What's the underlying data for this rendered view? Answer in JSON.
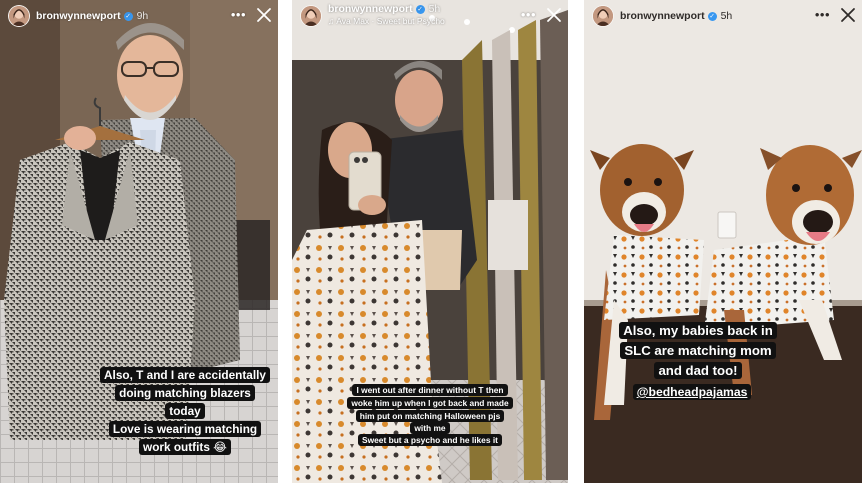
{
  "stories": [
    {
      "username": "bronwynnewport",
      "time": "9h",
      "captions": [
        [
          "Also, T and I are accidentally",
          "doing matching blazers",
          "today"
        ],
        [
          "Love is wearing matching",
          "work outfits 😂"
        ]
      ]
    },
    {
      "username": "bronwynnewport",
      "time": "5h",
      "music": "♫ Ava Max · Sweet but Psycho",
      "captions": [
        [
          "I went out after dinner without T then",
          "woke him up when I got back and made",
          "him put on matching Halloween pjs",
          "with me"
        ],
        [
          "Sweet but a psycho and he likes it"
        ]
      ]
    },
    {
      "username": "bronwynnewport",
      "time": "5h",
      "captions": [
        [
          "Also, my babies back in",
          "SLC are matching mom",
          "and dad too!"
        ]
      ],
      "mention": "@bedheadpajamas"
    }
  ],
  "icons": {
    "more": "more-horizontal-icon",
    "close": "close-icon",
    "verified": "verified-badge-icon"
  },
  "colors": {
    "caption_bg": "#111111",
    "caption_text": "#ffffff",
    "verified": "#3897f0"
  }
}
